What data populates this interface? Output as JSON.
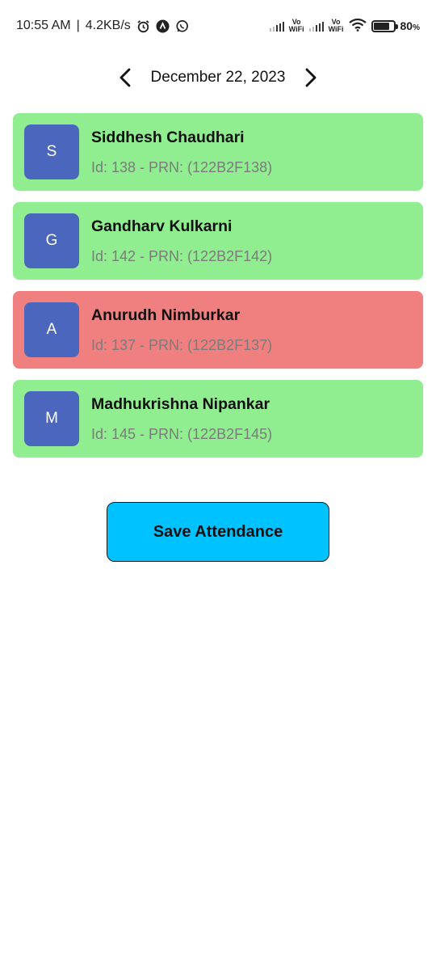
{
  "status_bar": {
    "time": "10:55 AM",
    "speed": "4.2KB/s",
    "vowifi_top": "Vo",
    "vowifi_bottom": "WiFi",
    "battery": "80",
    "battery_unit": "%",
    "battery_level": 0.8,
    "icons": [
      "alarm-icon",
      "app-icon",
      "whatsapp-icon",
      "signal-icon",
      "wifi-icon",
      "battery-icon"
    ]
  },
  "date_nav": {
    "date": "December 22, 2023",
    "prev_icon": "chevron-left-icon",
    "next_icon": "chevron-right-icon"
  },
  "colors": {
    "present": "#90ee90",
    "absent": "#f08080",
    "avatar": "#4a67bd",
    "button": "#00c2ff"
  },
  "students": [
    {
      "initial": "S",
      "name": "Siddhesh Chaudhari",
      "meta": "Id: 138 - PRN: (122B2F138)",
      "status": "present"
    },
    {
      "initial": "G",
      "name": "Gandharv Kulkarni",
      "meta": "Id: 142 - PRN: (122B2F142)",
      "status": "present"
    },
    {
      "initial": "A",
      "name": "Anurudh Nimburkar",
      "meta": "Id: 137 - PRN: (122B2F137)",
      "status": "absent"
    },
    {
      "initial": "M",
      "name": "Madhukrishna Nipankar",
      "meta": "Id: 145 - PRN: (122B2F145)",
      "status": "present"
    }
  ],
  "save_button": {
    "label": "Save Attendance"
  }
}
